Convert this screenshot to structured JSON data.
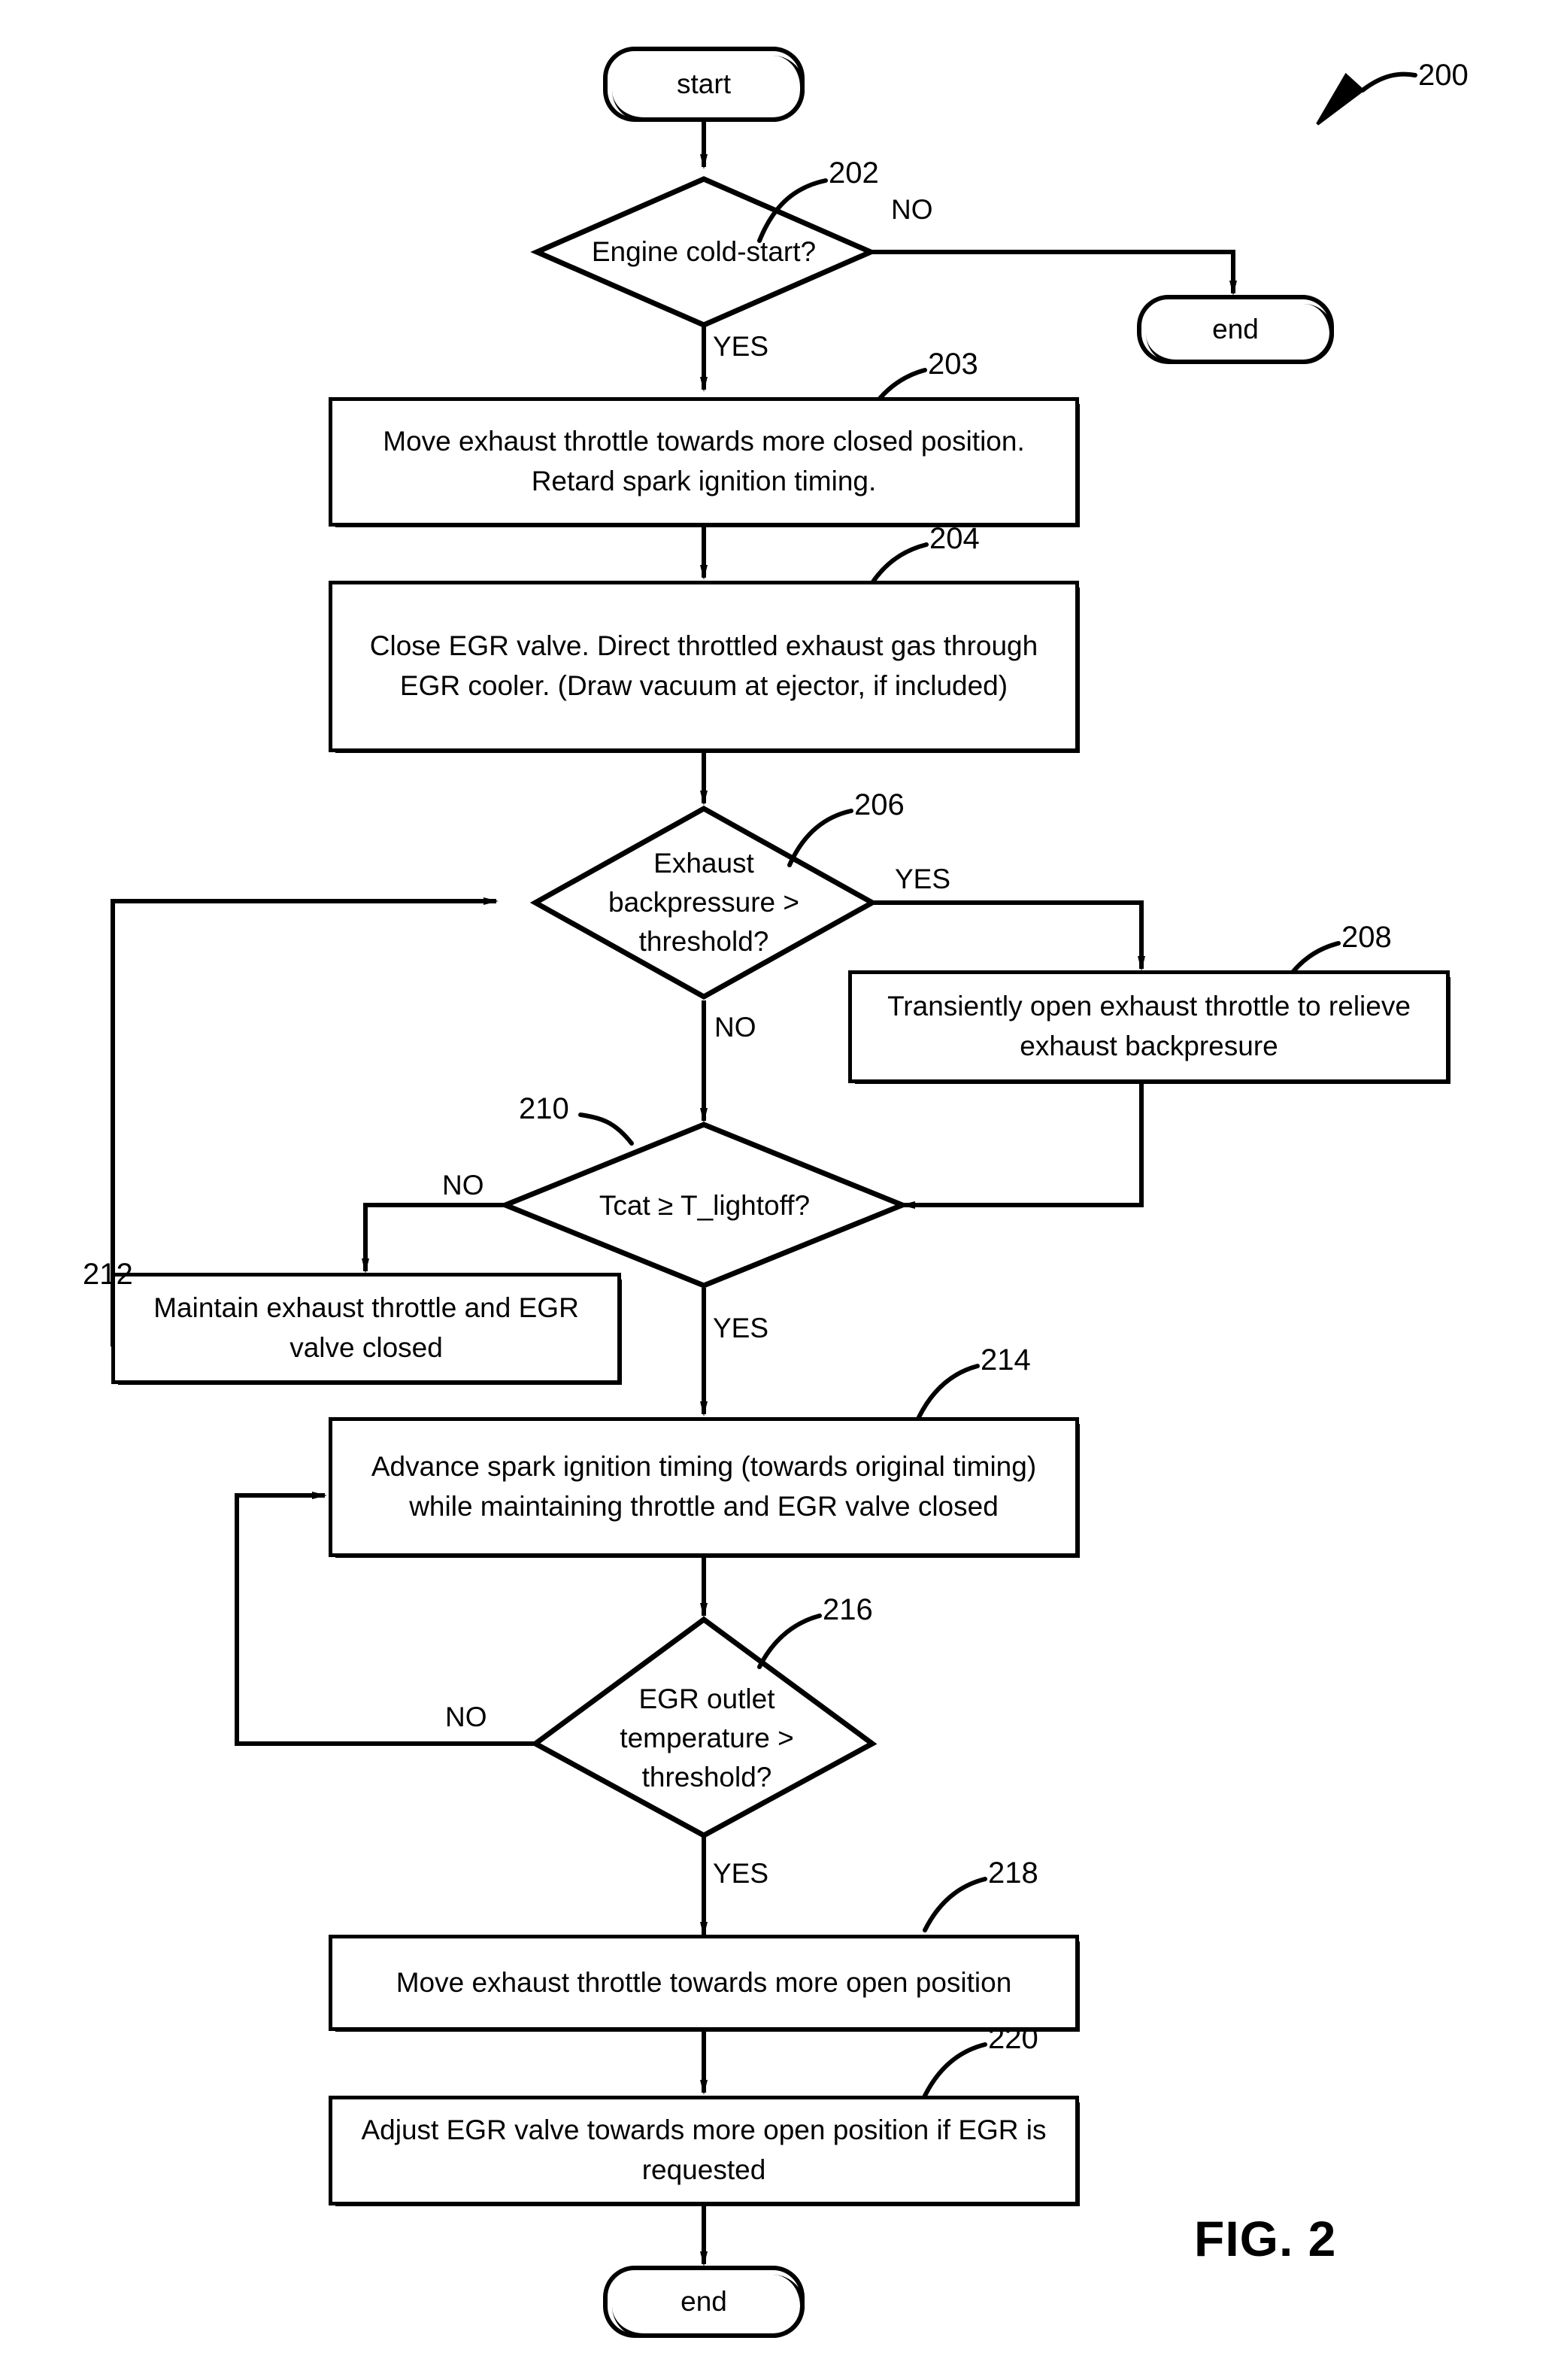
{
  "figure": {
    "label": "FIG. 2",
    "diagram_ref": "200"
  },
  "nodes": {
    "start": {
      "ref": "",
      "text": "start",
      "shape": "terminator"
    },
    "n202": {
      "ref": "202",
      "text": "Engine cold-start?",
      "shape": "decision"
    },
    "end_top": {
      "ref": "",
      "text": "end",
      "shape": "terminator"
    },
    "n203": {
      "ref": "203",
      "text": "Move exhaust throttle towards more closed position. Retard spark ignition timing.",
      "shape": "process"
    },
    "n204": {
      "ref": "204",
      "text": "Close EGR valve. Direct throttled exhaust gas through EGR cooler. (Draw vacuum at ejector, if included)",
      "shape": "process"
    },
    "n206": {
      "ref": "206",
      "text": "Exhaust backpressure > threshold?",
      "shape": "decision"
    },
    "n208": {
      "ref": "208",
      "text": "Transiently open exhaust throttle to relieve exhaust backpresure",
      "shape": "process"
    },
    "n210": {
      "ref": "210",
      "text": "Tcat ≥ T_lightoff?",
      "shape": "decision"
    },
    "n212": {
      "ref": "212",
      "text": "Maintain exhaust throttle and EGR valve closed",
      "shape": "process"
    },
    "n214": {
      "ref": "214",
      "text": "Advance spark ignition timing (towards original timing) while maintaining throttle and EGR valve closed",
      "shape": "process"
    },
    "n216": {
      "ref": "216",
      "text": "EGR outlet temperature > threshold?",
      "shape": "decision"
    },
    "n218": {
      "ref": "218",
      "text": "Move exhaust throttle towards more open position",
      "shape": "process"
    },
    "n220": {
      "ref": "220",
      "text": "Adjust EGR valve towards more open position if EGR is requested",
      "shape": "process"
    },
    "end_bottom": {
      "ref": "",
      "text": "end",
      "shape": "terminator"
    }
  },
  "edge_labels": {
    "e202_no": "NO",
    "e202_yes": "YES",
    "e206_yes": "YES",
    "e206_no": "NO",
    "e210_no": "NO",
    "e210_yes": "YES",
    "e216_no": "NO",
    "e216_yes": "YES"
  },
  "colors": {
    "ink": "#000000",
    "paper": "#ffffff"
  }
}
